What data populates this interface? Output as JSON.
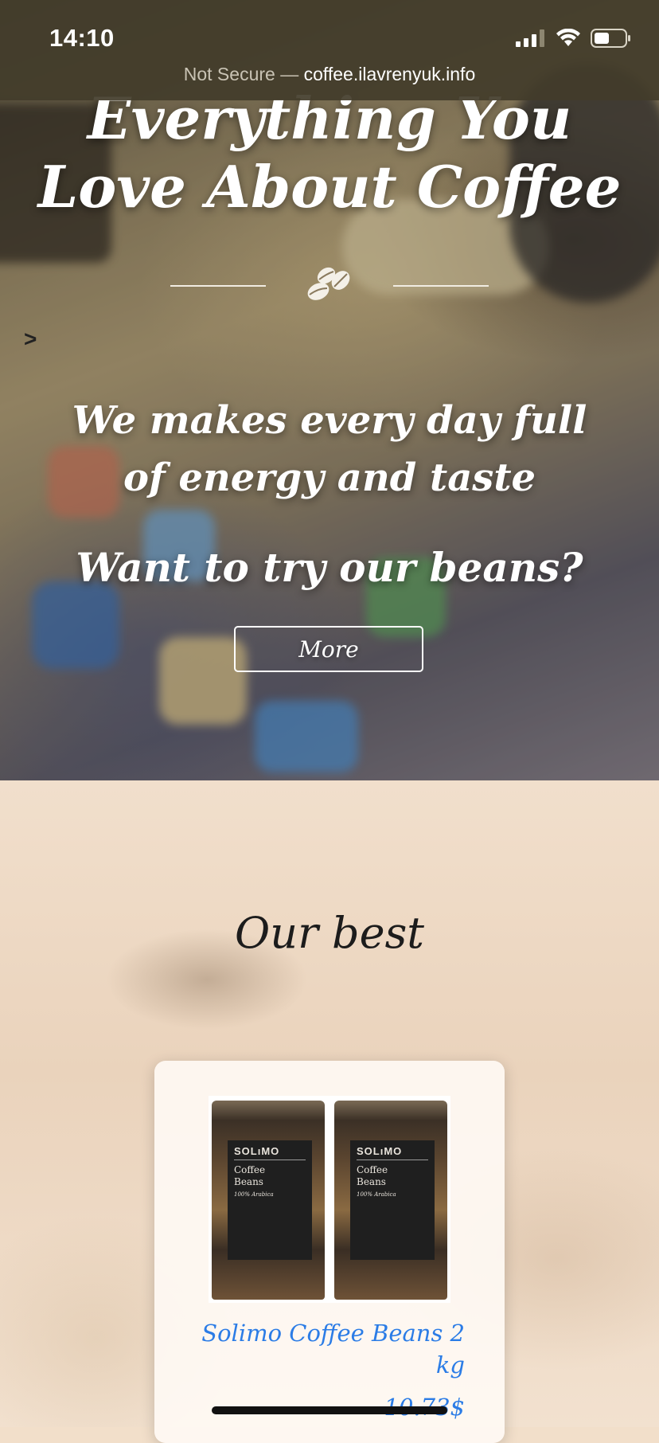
{
  "status_bar": {
    "time": "14:10",
    "icons": [
      "signal-icon",
      "wifi-icon",
      "battery-icon"
    ]
  },
  "url_bar": {
    "insecure_label": "Not Secure —",
    "host": "coffee.ilavrenyuk.info"
  },
  "hero": {
    "title": "Everything You Love About Coffee",
    "divider_icon": "coffee-beans-icon",
    "nav_arrow": ">",
    "subtitle": "We makes every day full of energy and taste",
    "question": "Want to try our beans?",
    "more_button": "More"
  },
  "best": {
    "title": "Our best",
    "products": [
      {
        "image": "coffee-bags-image",
        "bag_brand": "SOLıMO",
        "bag_name_line1": "Coffee",
        "bag_name_line2": "Beans",
        "bag_sub": "100% Arabica",
        "name": "Solimo Coffee Beans 2 kg",
        "price": "10.73$"
      }
    ]
  },
  "colors": {
    "accent_link": "#2b7ce6",
    "hero_text": "#ffffff",
    "section_bg": "#f2dfca"
  }
}
